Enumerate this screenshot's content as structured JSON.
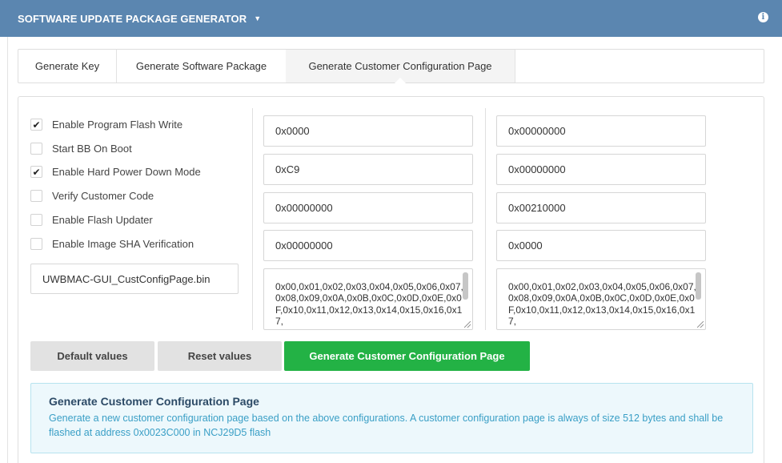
{
  "header": {
    "title": "SOFTWARE UPDATE PACKAGE GENERATOR",
    "caret": "▼",
    "info_icon": "info-icon"
  },
  "tabs": [
    {
      "label": "Generate Key",
      "active": false
    },
    {
      "label": "Generate Software Package",
      "active": false
    },
    {
      "label": "Generate Customer Configuration Page",
      "active": true
    }
  ],
  "options": [
    {
      "label": "Enable Program Flash Write",
      "checked": true
    },
    {
      "label": "Start BB On Boot",
      "checked": false
    },
    {
      "label": "Enable Hard Power Down Mode",
      "checked": true
    },
    {
      "label": "Verify Customer Code",
      "checked": false
    },
    {
      "label": "Enable Flash Updater",
      "checked": false
    },
    {
      "label": "Enable Image SHA Verification",
      "checked": false
    }
  ],
  "check_mark": "✔",
  "output_filename": "UWBMAC-GUI_CustConfigPage.bin",
  "column1": {
    "fields": [
      "0x0000",
      "0xC9",
      "0x00000000",
      "0x00000000"
    ],
    "textarea": "0x00,0x01,0x02,0x03,0x04,0x05,0x06,0x07,0x08,0x09,0x0A,0x0B,0x0C,0x0D,0x0E,0x0F,0x10,0x11,0x12,0x13,0x14,0x15,0x16,0x17,"
  },
  "column2": {
    "fields": [
      "0x00000000",
      "0x00000000",
      "0x00210000",
      "0x0000"
    ],
    "textarea": "0x00,0x01,0x02,0x03,0x04,0x05,0x06,0x07,0x08,0x09,0x0A,0x0B,0x0C,0x0D,0x0E,0x0F,0x10,0x11,0x12,0x13,0x14,0x15,0x16,0x17,"
  },
  "buttons": {
    "default": "Default values",
    "reset": "Reset values",
    "generate": "Generate Customer Configuration Page"
  },
  "info": {
    "heading": "Generate Customer Configuration Page",
    "description": "Generate a new customer configuration page based on the above configurations. A customer configuration page is always of size 512 bytes and shall be flashed at address 0x0023C000 in NCJ29D5 flash"
  },
  "colors": {
    "header": "#5b86b0",
    "primary_button": "#23b245",
    "info_bg": "#edf8fc",
    "info_text": "#3a9fc6"
  }
}
